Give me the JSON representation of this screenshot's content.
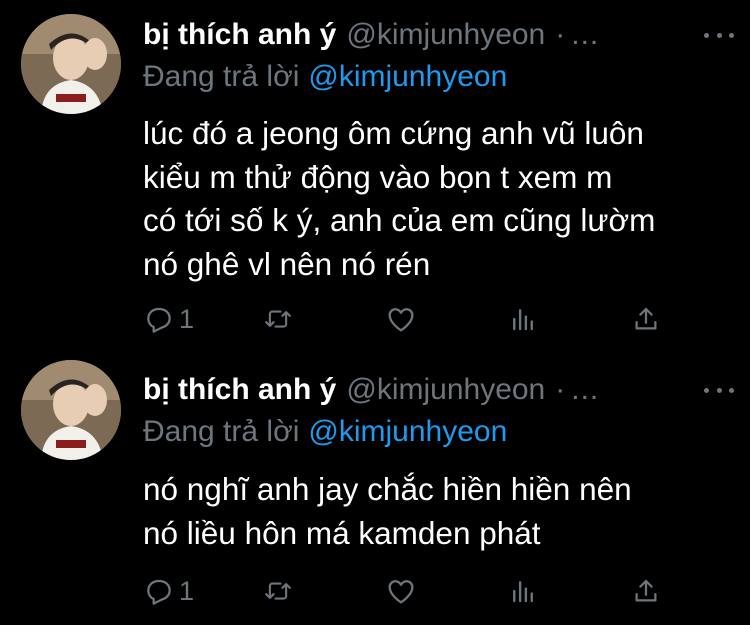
{
  "tweets": [
    {
      "display_name": "bị thích anh ý",
      "handle": "@kimjunhyeon",
      "separator": "·",
      "ellipsis": "...",
      "reply_prefix": "Đang trả lời",
      "reply_to": "@kimjunhyeon",
      "text_lines": [
        "lúc đó a jeong ôm cứng anh vũ luôn",
        "kiểu m thử động vào bọn t xem m",
        "có tới số k ý, anh của em cũng lườm",
        "nó ghê vl nên nó rén"
      ],
      "reply_count": "1",
      "icons": {
        "reply": "reply-icon",
        "retweet": "retweet-icon",
        "like": "heart-icon",
        "analytics": "analytics-icon",
        "share": "share-icon",
        "more": "more-icon"
      }
    },
    {
      "display_name": "bị thích anh ý",
      "handle": "@kimjunhyeon",
      "separator": "·",
      "ellipsis": "...",
      "reply_prefix": "Đang trả lời",
      "reply_to": "@kimjunhyeon",
      "text_lines": [
        "nó nghĩ anh jay chắc hiền hiền nên",
        "nó liều hôn má kamden phát"
      ],
      "reply_count": "1",
      "icons": {
        "reply": "reply-icon",
        "retweet": "retweet-icon",
        "like": "heart-icon",
        "analytics": "analytics-icon",
        "share": "share-icon",
        "more": "more-icon"
      }
    }
  ],
  "colors": {
    "background": "#000000",
    "name": "#ffffff",
    "muted": "#6e767d",
    "link": "#1d9bf0",
    "text": "#ffffff"
  }
}
